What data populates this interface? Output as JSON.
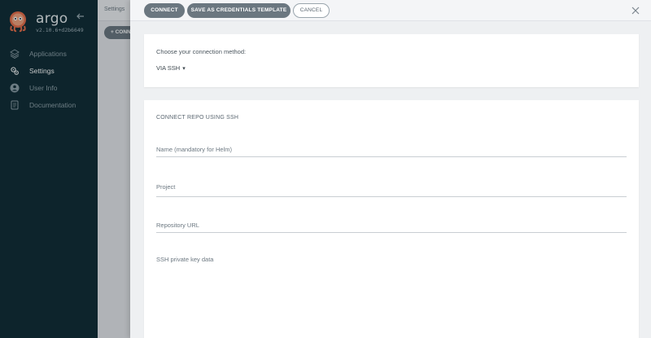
{
  "sidebar": {
    "brand": "argo",
    "version": "v2.10.6+d2b6649",
    "items": [
      {
        "label": "Applications",
        "icon": "layers-icon",
        "active": false
      },
      {
        "label": "Settings",
        "icon": "gears-icon",
        "active": true
      },
      {
        "label": "User Info",
        "icon": "user-circle-icon",
        "active": false
      },
      {
        "label": "Documentation",
        "icon": "book-icon",
        "active": false
      }
    ]
  },
  "background": {
    "breadcrumb": "Settings",
    "connect_button": "+ CONN"
  },
  "panel": {
    "buttons": {
      "connect": "CONNECT",
      "save_template": "SAVE AS CREDENTIALS TEMPLATE",
      "cancel": "CANCEL"
    },
    "method": {
      "prompt": "Choose your connection method:",
      "selected": "VIA SSH"
    },
    "form": {
      "title": "CONNECT REPO USING SSH",
      "name_placeholder": "Name (mandatory for Helm)",
      "project_placeholder": "Project",
      "repo_url_placeholder": "Repository URL",
      "ssh_key_label": "SSH private key data"
    }
  },
  "colors": {
    "sidebar_bg": "#0e2a33",
    "button_dark": "#6b7780"
  }
}
